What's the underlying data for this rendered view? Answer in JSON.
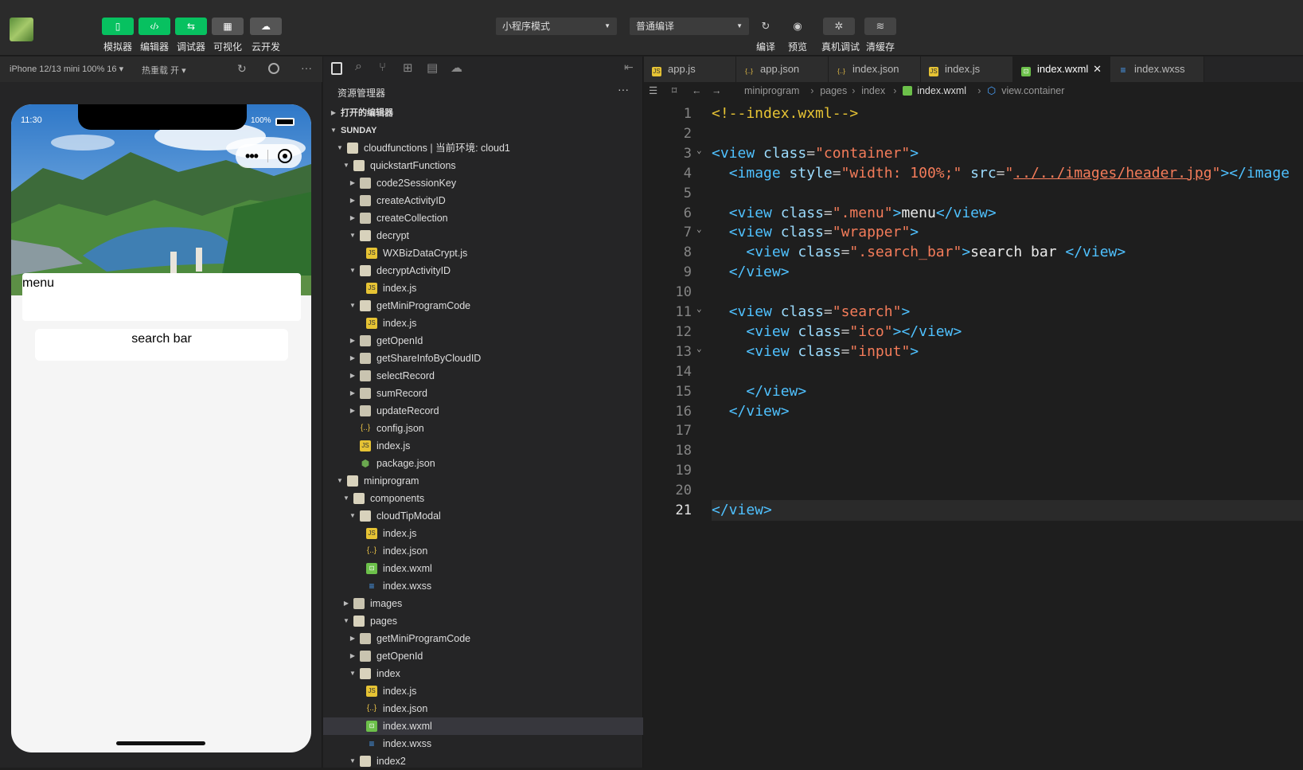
{
  "toolbar": {
    "left_buttons": [
      {
        "label": "模拟器",
        "icon": "phone-icon"
      },
      {
        "label": "编辑器",
        "icon": "code-icon"
      },
      {
        "label": "调试器",
        "icon": "debug-icon"
      },
      {
        "label": "可视化",
        "icon": "layout-icon"
      },
      {
        "label": "云开发",
        "icon": "cloud-icon"
      }
    ],
    "mode_select": "小程序模式",
    "compile_select": "普通编译",
    "right_buttons": [
      {
        "label": "编译",
        "icon": "refresh-icon"
      },
      {
        "label": "预览",
        "icon": "eye-icon"
      },
      {
        "label": "真机调试",
        "icon": "bug-icon"
      },
      {
        "label": "清缓存",
        "icon": "layers-icon"
      }
    ]
  },
  "simulator": {
    "device": "iPhone 12/13 mini 100% 16 ▾",
    "hot_reload": "热重载 开 ▾",
    "status_time": "11:30",
    "battery": "100%",
    "menu_text": "menu",
    "search_text": "search bar"
  },
  "explorer": {
    "title": "资源管理器",
    "more": "···",
    "tree": [
      {
        "depth": 0,
        "kind": "section-collapsed",
        "name": "打开的编辑器"
      },
      {
        "depth": 0,
        "kind": "section",
        "name": "SUNDAY"
      },
      {
        "depth": 1,
        "kind": "folder-open",
        "name": "cloudfunctions | 当前环境: cloud1"
      },
      {
        "depth": 2,
        "kind": "folder-open",
        "name": "quickstartFunctions"
      },
      {
        "depth": 3,
        "kind": "folder",
        "name": "code2SessionKey"
      },
      {
        "depth": 3,
        "kind": "folder",
        "name": "createActivityID"
      },
      {
        "depth": 3,
        "kind": "folder",
        "name": "createCollection"
      },
      {
        "depth": 3,
        "kind": "folder-open",
        "name": "decrypt"
      },
      {
        "depth": 4,
        "kind": "js",
        "name": "WXBizDataCrypt.js"
      },
      {
        "depth": 3,
        "kind": "folder-open",
        "name": "decryptActivityID"
      },
      {
        "depth": 4,
        "kind": "js",
        "name": "index.js"
      },
      {
        "depth": 3,
        "kind": "folder-open",
        "name": "getMiniProgramCode"
      },
      {
        "depth": 4,
        "kind": "js",
        "name": "index.js"
      },
      {
        "depth": 3,
        "kind": "folder",
        "name": "getOpenId"
      },
      {
        "depth": 3,
        "kind": "folder",
        "name": "getShareInfoByCloudID"
      },
      {
        "depth": 3,
        "kind": "folder",
        "name": "selectRecord"
      },
      {
        "depth": 3,
        "kind": "folder",
        "name": "sumRecord"
      },
      {
        "depth": 3,
        "kind": "folder",
        "name": "updateRecord"
      },
      {
        "depth": 3,
        "kind": "json",
        "name": "config.json"
      },
      {
        "depth": 3,
        "kind": "js",
        "name": "index.js"
      },
      {
        "depth": 3,
        "kind": "pkg",
        "name": "package.json"
      },
      {
        "depth": 1,
        "kind": "folder-open",
        "name": "miniprogram"
      },
      {
        "depth": 2,
        "kind": "folder-open",
        "name": "components"
      },
      {
        "depth": 3,
        "kind": "folder-open",
        "name": "cloudTipModal"
      },
      {
        "depth": 4,
        "kind": "js",
        "name": "index.js"
      },
      {
        "depth": 4,
        "kind": "json",
        "name": "index.json"
      },
      {
        "depth": 4,
        "kind": "wxml",
        "name": "index.wxml"
      },
      {
        "depth": 4,
        "kind": "wxss",
        "name": "index.wxss"
      },
      {
        "depth": 2,
        "kind": "folder",
        "name": "images"
      },
      {
        "depth": 2,
        "kind": "folder-open",
        "name": "pages"
      },
      {
        "depth": 3,
        "kind": "folder",
        "name": "getMiniProgramCode"
      },
      {
        "depth": 3,
        "kind": "folder",
        "name": "getOpenId"
      },
      {
        "depth": 3,
        "kind": "folder-open",
        "name": "index"
      },
      {
        "depth": 4,
        "kind": "js",
        "name": "index.js"
      },
      {
        "depth": 4,
        "kind": "json",
        "name": "index.json"
      },
      {
        "depth": 4,
        "kind": "wxml",
        "name": "index.wxml",
        "selected": true
      },
      {
        "depth": 4,
        "kind": "wxss",
        "name": "index.wxss"
      },
      {
        "depth": 3,
        "kind": "folder-open",
        "name": "index2"
      }
    ]
  },
  "tabs": [
    {
      "kind": "js",
      "name": "app.js"
    },
    {
      "kind": "json",
      "name": "app.json"
    },
    {
      "kind": "json",
      "name": "index.json"
    },
    {
      "kind": "js",
      "name": "index.js"
    },
    {
      "kind": "wxml",
      "name": "index.wxml",
      "active": true
    },
    {
      "kind": "wxss",
      "name": "index.wxss"
    }
  ],
  "breadcrumb": [
    "miniprogram",
    "pages",
    "index",
    "index.wxml",
    "view.container"
  ],
  "editor": {
    "current_line": 21,
    "lines": [
      [
        [
          "cm",
          "<!--index.wxml-->"
        ]
      ],
      [],
      [
        [
          "tg",
          "<view "
        ],
        [
          "at",
          "class"
        ],
        [
          "pu",
          "="
        ],
        [
          "st",
          "\"container\""
        ],
        [
          "tg",
          ">"
        ]
      ],
      [
        [
          "pu",
          "  "
        ],
        [
          "tg",
          "<image "
        ],
        [
          "at",
          "style"
        ],
        [
          "pu",
          "="
        ],
        [
          "st",
          "\"width: 100%;\""
        ],
        [
          "pu",
          " "
        ],
        [
          "at",
          "src"
        ],
        [
          "pu",
          "="
        ],
        [
          "st",
          "\""
        ],
        [
          "ln",
          "../../images/header.jpg"
        ],
        [
          "st",
          "\""
        ],
        [
          "tg",
          "></image"
        ]
      ],
      [],
      [
        [
          "pu",
          "  "
        ],
        [
          "tg",
          "<view "
        ],
        [
          "at",
          "class"
        ],
        [
          "pu",
          "="
        ],
        [
          "st",
          "\".menu\""
        ],
        [
          "tg",
          ">"
        ],
        [
          "tx",
          "menu"
        ],
        [
          "tg",
          "</view>"
        ]
      ],
      [
        [
          "pu",
          "  "
        ],
        [
          "tg",
          "<view "
        ],
        [
          "at",
          "class"
        ],
        [
          "pu",
          "="
        ],
        [
          "st",
          "\"wrapper\""
        ],
        [
          "tg",
          ">"
        ]
      ],
      [
        [
          "pu",
          "    "
        ],
        [
          "tg",
          "<view "
        ],
        [
          "at",
          "class"
        ],
        [
          "pu",
          "="
        ],
        [
          "st",
          "\".search_bar\""
        ],
        [
          "tg",
          ">"
        ],
        [
          "tx",
          "search bar "
        ],
        [
          "tg",
          "</view>"
        ]
      ],
      [
        [
          "pu",
          "  "
        ],
        [
          "tg",
          "</view>"
        ]
      ],
      [],
      [
        [
          "pu",
          "  "
        ],
        [
          "tg",
          "<view "
        ],
        [
          "at",
          "class"
        ],
        [
          "pu",
          "="
        ],
        [
          "st",
          "\"search\""
        ],
        [
          "tg",
          ">"
        ]
      ],
      [
        [
          "pu",
          "    "
        ],
        [
          "tg",
          "<view "
        ],
        [
          "at",
          "class"
        ],
        [
          "pu",
          "="
        ],
        [
          "st",
          "\"ico\""
        ],
        [
          "tg",
          "></view>"
        ]
      ],
      [
        [
          "pu",
          "    "
        ],
        [
          "tg",
          "<view "
        ],
        [
          "at",
          "class"
        ],
        [
          "pu",
          "="
        ],
        [
          "st",
          "\"input\""
        ],
        [
          "tg",
          ">"
        ]
      ],
      [],
      [
        [
          "pu",
          "    "
        ],
        [
          "tg",
          "</view>"
        ]
      ],
      [
        [
          "pu",
          "  "
        ],
        [
          "tg",
          "</view>"
        ]
      ],
      [],
      [],
      [],
      [],
      [
        [
          "tg",
          "</view>"
        ]
      ]
    ],
    "fold_lines": [
      3,
      7,
      11,
      13
    ]
  }
}
